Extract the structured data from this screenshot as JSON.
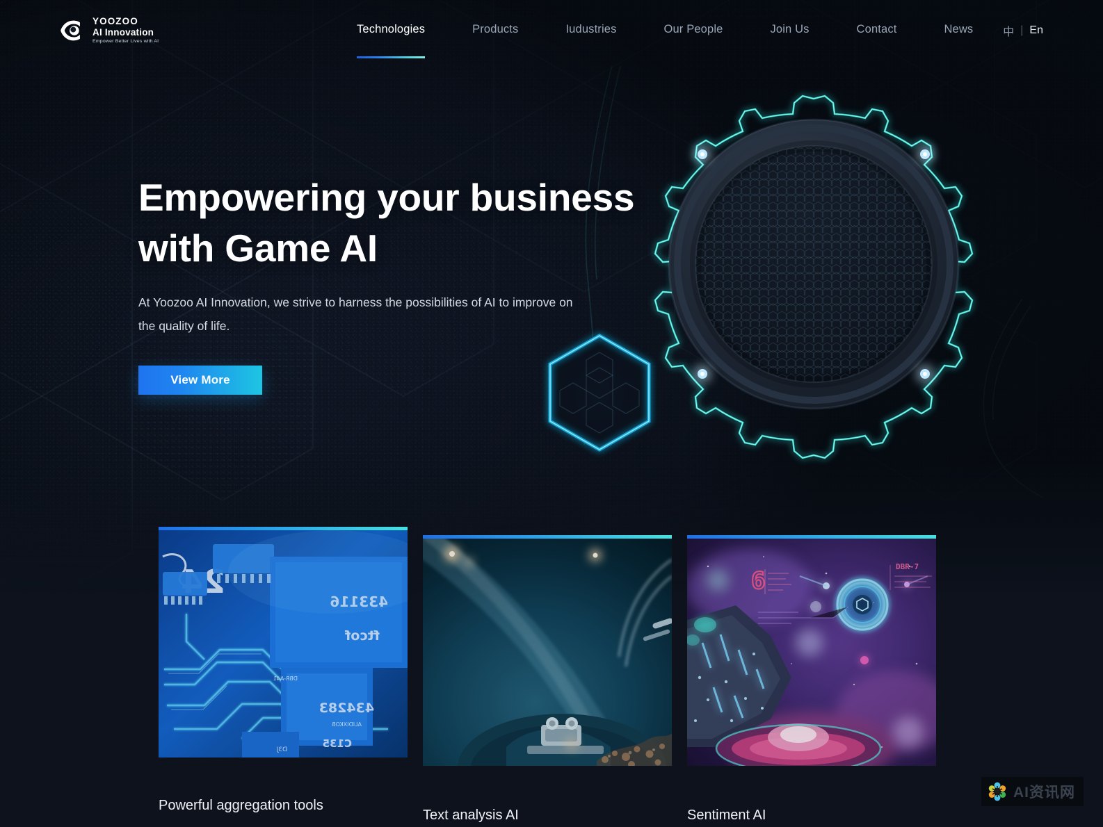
{
  "site": {
    "background_color": "#101622",
    "accent_from": "#1f73ef",
    "accent_to": "#1ec5e2"
  },
  "header": {
    "logo": {
      "icon": "eye-logo-icon",
      "line1": "YOOZOO",
      "line2": "AI Innovation",
      "tagline": "Empower Better Lives with AI"
    },
    "nav": [
      {
        "label": "Technologies",
        "active": true
      },
      {
        "label": "Products",
        "active": false
      },
      {
        "label": "Iudustries",
        "active": false
      },
      {
        "label": "Our People",
        "active": false
      },
      {
        "label": "Join Us",
        "active": false
      },
      {
        "label": "Contact",
        "active": false
      },
      {
        "label": "News",
        "active": false
      }
    ],
    "language": {
      "cn": "中",
      "separator": "|",
      "en": "En"
    }
  },
  "hero": {
    "title_line1": "Empowering your business",
    "title_line2": "with Game AI",
    "subtitle": "At Yoozoo AI Innovation, we strive to harness the possibilities of AI to improve on the quality of life.",
    "cta_label": "View More",
    "art": {
      "gear": "gear-ring-graphic",
      "hexagon": "glowing-hexagon-graphic"
    }
  },
  "cards": [
    {
      "title": "Powerful aggregation tools",
      "image": "circuit-board-image"
    },
    {
      "title": "Text analysis AI",
      "image": "machinery-closeup-image"
    },
    {
      "title": "Sentiment AI",
      "image": "sci-fi-space-image"
    }
  ],
  "watermark": {
    "icon": "flower-pinwheel-icon",
    "text": "AI资讯网"
  }
}
